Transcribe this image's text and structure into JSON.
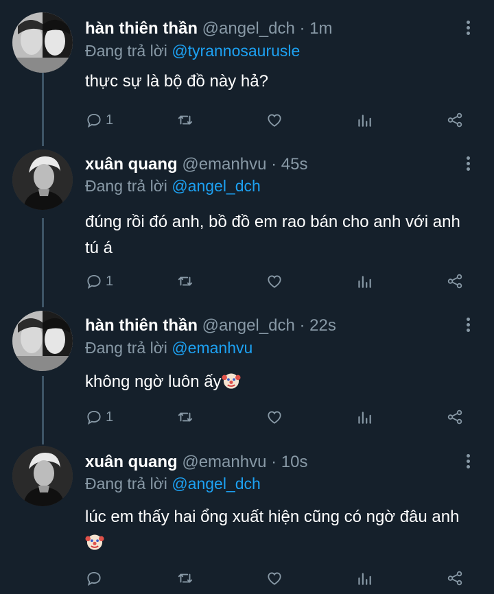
{
  "labels": {
    "replying_to": "Đang trả lời"
  },
  "colors": {
    "background": "#15202b",
    "secondary_text": "#8899a6",
    "mention": "#1da1f2",
    "thread_line": "#3d5466"
  },
  "tweets": [
    {
      "name": "hàn thiên thần",
      "handle": "@angel_dch",
      "separator": "·",
      "time": "1m",
      "reply_to": "@tyrannosaurusle",
      "text": "thực sự là bộ đồ này hả?",
      "reply_count": "1",
      "avatar": "two-faces-avatar",
      "emoji": ""
    },
    {
      "name": "xuân quang",
      "handle": "@emanhvu",
      "separator": "·",
      "time": "45s",
      "reply_to": "@angel_dch",
      "text": "đúng rồi đó anh, bồ đồ em rao bán cho anh với anh tú á",
      "reply_count": "1",
      "avatar": "man-portrait-avatar",
      "emoji": ""
    },
    {
      "name": "hàn thiên thần",
      "handle": "@angel_dch",
      "separator": "·",
      "time": "22s",
      "reply_to": "@emanhvu",
      "text": "không ngờ luôn ấy",
      "reply_count": "1",
      "avatar": "two-faces-avatar",
      "emoji": "clown-face"
    },
    {
      "name": "xuân quang",
      "handle": "@emanhvu",
      "separator": "·",
      "time": "10s",
      "reply_to": "@angel_dch",
      "text": "lúc em thấy hai ổng xuất hiện cũng có ngờ đâu anh",
      "reply_count": "",
      "avatar": "man-portrait-avatar",
      "emoji": "clown-face"
    }
  ]
}
